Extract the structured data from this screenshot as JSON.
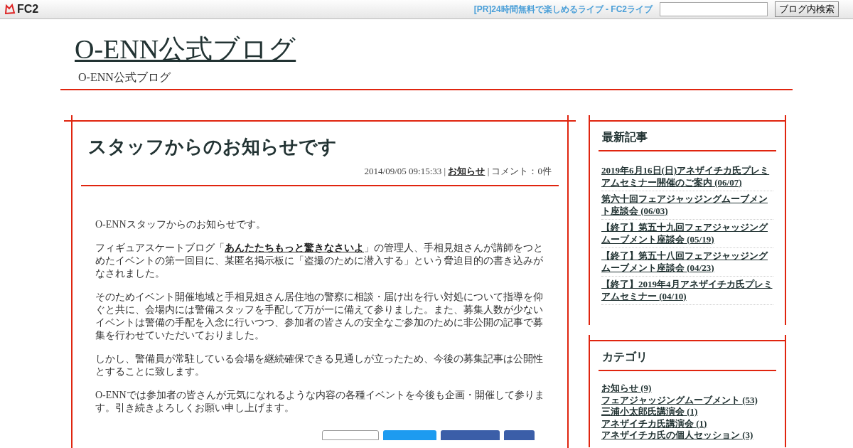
{
  "topbar": {
    "logo": "FC2",
    "ad_link": "[PR]24時間無料で楽しめるライブ - FC2ライブ",
    "search_button": "ブログ内検索"
  },
  "header": {
    "title": "O-ENN公式ブログ",
    "subtitle": "O-ENN公式ブログ"
  },
  "entry": {
    "title": "スタッフからのお知らせです",
    "date": "2014/09/05 09:15:33 |",
    "category": "お知らせ",
    "comments": "| コメント：0件",
    "paragraphs": [
      {
        "before": "O-ENNスタッフからのお知らせです。"
      },
      {
        "before": "フィギュアスケートブログ「",
        "link": "あんたたちもっと驚きなさいよ",
        "after": "」の管理人、手相見姐さんが講師をつとめたイベントの第一回目に、某匿名掲示板に「盗撮のために潜入する」という脅迫目的の書き込みがなされました。"
      },
      {
        "before": "そのためイベント開催地域と手相見姐さん居住地の警察に相談・届け出を行い対処について指導を仰ぐと共に、会場内には警備スタッフを手配して万が一に備えて参りました。また、募集人数が少ないイベントは警備の手配を入念に行いつつ、参加者の皆さんの安全なご参加のために非公開の記事で募集を行わせていただいておりました。"
      },
      {
        "before": "しかし、警備員が常駐している会場を継続確保できる見通しが立ったため、今後の募集記事は公開性とすることに致します。"
      },
      {
        "before": "O-ENNでは参加者の皆さんが元気になれるような内容の各種イベントを今後も企画・開催して参ります。引き続きよろしくお願い申し上げます。"
      }
    ],
    "share_buttons": [
      {
        "kind": "hatena"
      },
      {
        "kind": "twitter"
      },
      {
        "kind": "facebook"
      },
      {
        "kind": "other"
      }
    ]
  },
  "sidebar": [
    {
      "title": "最新記事",
      "kind": "recent",
      "items": [
        {
          "label": "2019年6月16日(日)アネザイチカ氏プレミアムセミナー開催のご案内",
          "note": "(06/07)"
        },
        {
          "label": "第六十回フェアジャッジングムーブメント座談会",
          "note": "(06/03)"
        },
        {
          "label": "【終了】第五十九回フェアジャッジングムーブメント座談会",
          "note": "(05/19)"
        },
        {
          "label": "【終了】第五十八回フェアジャッジングムーブメント座談会",
          "note": "(04/23)"
        },
        {
          "label": "【終了】2019年4月アネザイチカ氏プレミアムセミナー",
          "note": "(04/10)"
        }
      ]
    },
    {
      "title": "カテゴリ",
      "kind": "category",
      "items": [
        {
          "label": "お知らせ",
          "note": "(9)"
        },
        {
          "label": "フェアジャッジングムーブメント",
          "note": "(53)"
        },
        {
          "label": "三浦小太郎氏講演会",
          "note": "(1)"
        },
        {
          "label": "アネザイチカ氏講演会",
          "note": "(1)"
        },
        {
          "label": "アネザイチカ氏の個人セッション",
          "note": "(3)"
        }
      ]
    }
  ]
}
